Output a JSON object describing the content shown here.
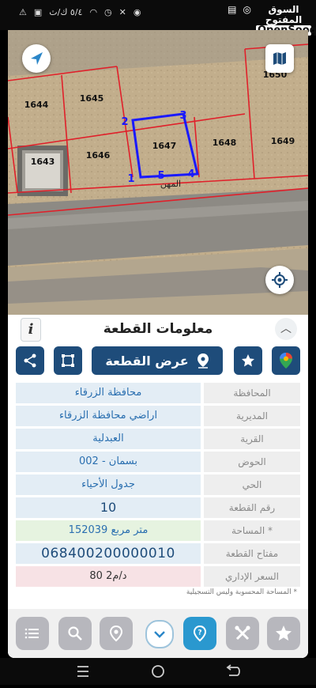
{
  "status_bar": {
    "left_text": "٥/٤ ك/ث",
    "time": ""
  },
  "watermark": {
    "arabic": "السوق المفتوح",
    "english": "OpenSooq"
  },
  "map": {
    "parcels": [
      "1644",
      "1645",
      "1643",
      "1646",
      "1647",
      "1648",
      "1649",
      "1650"
    ],
    "vertices": [
      "1",
      "2",
      "3",
      "4",
      "5"
    ],
    "road_label": "المهن"
  },
  "panel": {
    "title": "معلومات القطعة",
    "show_parcel_label": "عرض القطعة"
  },
  "details": [
    {
      "label": "المحافظة",
      "value": "محافظة الزرقاء",
      "style": "normal"
    },
    {
      "label": "المديرية",
      "value": "اراضي محافظة الزرقاء",
      "style": "normal"
    },
    {
      "label": "القرية",
      "value": "العبدلية",
      "style": "normal"
    },
    {
      "label": "الحوض",
      "value": "بسمان - 002",
      "style": "normal"
    },
    {
      "label": "الحي",
      "value": "جدول الأحياء",
      "style": "normal"
    },
    {
      "label": "رقم القطعة",
      "value": "10",
      "style": "num"
    },
    {
      "label": "المساحة *",
      "value": "152039  متر مربع",
      "style": "green"
    },
    {
      "label": "مفتاح القطعة",
      "value": "068400200000010",
      "style": "big"
    },
    {
      "label": "السعر الإداري",
      "value": "80 د/م2",
      "style": "red"
    }
  ],
  "footnote": "* المساحة المحسوبة وليس التسجيلية",
  "colors": {
    "primary": "#1e4c7a",
    "accent": "#2a98cf",
    "parcel_highlight": "#1a1aff",
    "boundary": "#e0202a"
  }
}
